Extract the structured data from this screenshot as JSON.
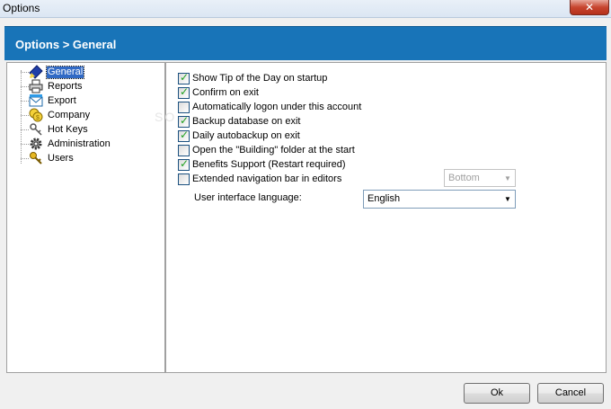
{
  "window": {
    "title": "Options",
    "close_label": "✕"
  },
  "header": {
    "breadcrumb": "Options > General"
  },
  "tree": {
    "items": [
      {
        "label": "General",
        "icon": "diamond-pen-icon",
        "selected": true
      },
      {
        "label": "Reports",
        "icon": "printer-icon",
        "selected": false
      },
      {
        "label": "Export",
        "icon": "envelope-icon",
        "selected": false
      },
      {
        "label": "Company",
        "icon": "coins-icon",
        "selected": false
      },
      {
        "label": "Hot Keys",
        "icon": "keys-icon",
        "selected": false
      },
      {
        "label": "Administration",
        "icon": "gear-icon",
        "selected": false
      },
      {
        "label": "Users",
        "icon": "key-icon",
        "selected": false
      }
    ]
  },
  "options": [
    {
      "label": "Show Tip of the Day on startup",
      "checked": true
    },
    {
      "label": "Confirm on exit",
      "checked": true
    },
    {
      "label": "Automatically logon under this account",
      "checked": false
    },
    {
      "label": "Backup database on exit",
      "checked": true
    },
    {
      "label": "Daily autobackup on exit",
      "checked": true
    },
    {
      "label": "Open the \"Building\" folder at the start",
      "checked": false
    },
    {
      "label": "Benefits Support (Restart required)",
      "checked": true
    },
    {
      "label": "Extended navigation bar in editors",
      "checked": false
    }
  ],
  "navbar_position": {
    "value": "Bottom",
    "enabled": false
  },
  "language": {
    "label": "User interface language:",
    "value": "English"
  },
  "buttons": {
    "ok": "Ok",
    "cancel": "Cancel"
  },
  "watermark": "SO",
  "colors": {
    "header_bg": "#1874b8",
    "selection": "#316ac5",
    "check": "#21a121"
  }
}
